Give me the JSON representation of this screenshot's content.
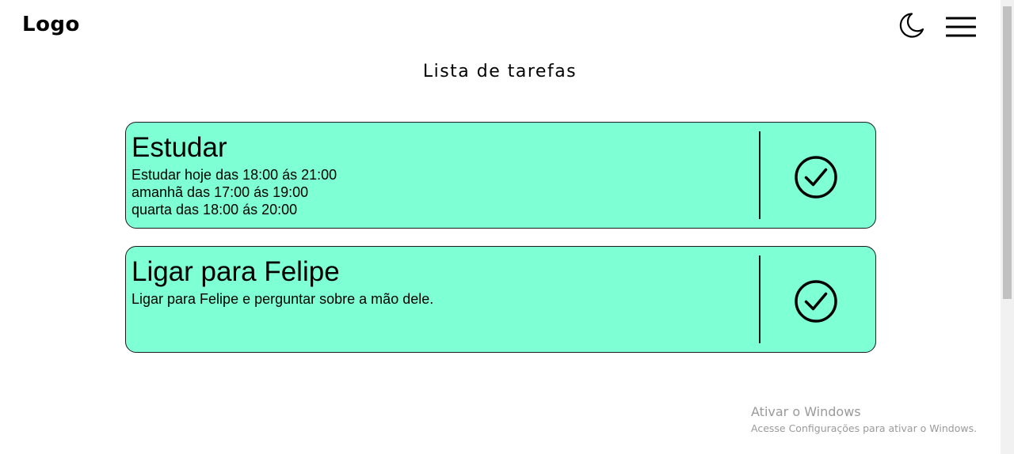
{
  "header": {
    "logo": "Logo",
    "theme_icon": "moon-icon",
    "menu_icon": "hamburger-menu-icon"
  },
  "main": {
    "title": "Lista de tarefas",
    "tasks": [
      {
        "title": "Estudar",
        "description": "Estudar hoje das 18:00 ás 21:00\namanhã das 17:00 ás 19:00\nquarta das 18:00 ás 20:00",
        "action_icon": "check-circle-icon"
      },
      {
        "title": "Ligar para Felipe",
        "description": "Ligar para Felipe e perguntar sobre a mão dele.",
        "action_icon": "check-circle-icon"
      }
    ]
  },
  "watermark": {
    "title": "Ativar o Windows",
    "subtitle": "Acesse Configurações para ativar o Windows."
  },
  "colors": {
    "card_background": "#7fffd4",
    "border": "#1a1a1a",
    "watermark_text": "#9a9a9a"
  }
}
